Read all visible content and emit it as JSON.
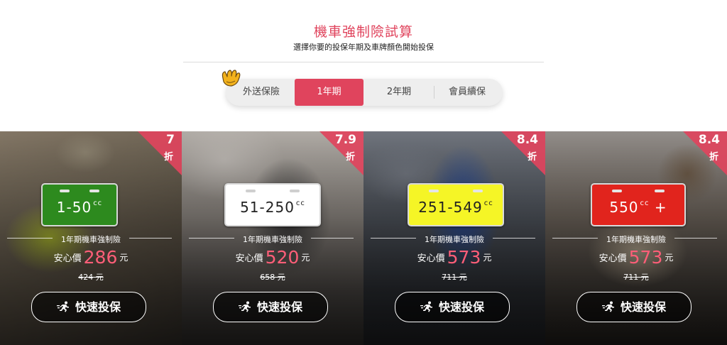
{
  "header": {
    "title": "機車強制險試算",
    "subtitle": "選擇你要的投保年期及車牌顏色開始投保"
  },
  "tabs": [
    {
      "label": "外送保險",
      "active": false
    },
    {
      "label": "1年期",
      "active": true
    },
    {
      "label": "2年期",
      "active": false
    },
    {
      "label": "會員續保",
      "active": false
    }
  ],
  "colors": {
    "accent": "#e0445d",
    "price": "#ff5e78",
    "plate_green": "#2d8a1e",
    "plate_white": "#ffffff",
    "plate_yellow": "#f5f526",
    "plate_red": "#e1241d"
  },
  "cards": [
    {
      "discount": "7",
      "discount_unit": "折",
      "plate_text": "1-50",
      "plate_cc": "cc",
      "plate_plus": "",
      "plan_label": "1年期機車強制險",
      "price_label": "安心價",
      "price": "286",
      "price_unit": "元",
      "original_price": "424 元",
      "button_label": "快速投保"
    },
    {
      "discount": "7.9",
      "discount_unit": "折",
      "plate_text": "51-250",
      "plate_cc": "cc",
      "plate_plus": "",
      "plan_label": "1年期機車強制險",
      "price_label": "安心價",
      "price": "520",
      "price_unit": "元",
      "original_price": "658 元",
      "button_label": "快速投保"
    },
    {
      "discount": "8.4",
      "discount_unit": "折",
      "plate_text": "251-549",
      "plate_cc": "cc",
      "plate_plus": "",
      "plan_label": "1年期機車強制險",
      "price_label": "安心價",
      "price": "573",
      "price_unit": "元",
      "original_price": "711 元",
      "button_label": "快速投保"
    },
    {
      "discount": "8.4",
      "discount_unit": "折",
      "plate_text": "550",
      "plate_cc": "cc",
      "plate_plus": "+",
      "plan_label": "1年期機車強制險",
      "price_label": "安心價",
      "price": "573",
      "price_unit": "元",
      "original_price": "711 元",
      "button_label": "快速投保"
    }
  ]
}
